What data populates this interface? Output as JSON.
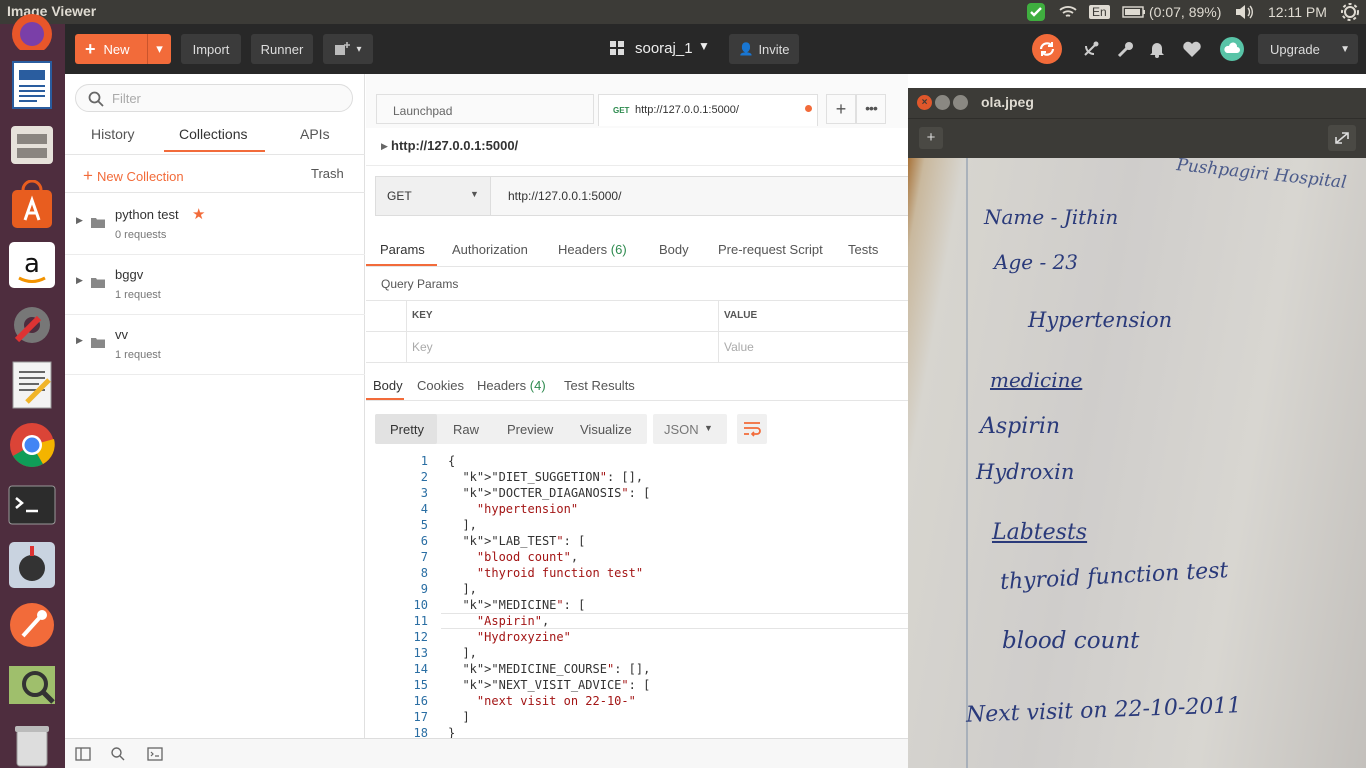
{
  "topbar": {
    "app_title": "Image Viewer",
    "keyboard": "En",
    "battery": "(0:07, 89%)",
    "clock": "12:11 PM"
  },
  "header": {
    "new_label": "New",
    "import_label": "Import",
    "runner_label": "Runner",
    "workspace": "sooraj_1",
    "invite_label": "Invite",
    "upgrade_label": "Upgrade"
  },
  "sidebar": {
    "filter_placeholder": "Filter",
    "tabs": [
      "History",
      "Collections",
      "APIs"
    ],
    "new_collection": "New Collection",
    "trash": "Trash",
    "collections": [
      {
        "name": "python test",
        "count": "0 requests",
        "starred": true
      },
      {
        "name": "bggv",
        "count": "1 request",
        "starred": false
      },
      {
        "name": "vv",
        "count": "1 request",
        "starred": false
      }
    ]
  },
  "request": {
    "tabs": [
      {
        "label": "Launchpad"
      },
      {
        "method": "GET",
        "label": "http://127.0.0.1:5000/"
      }
    ],
    "breadcrumb": "http://127.0.0.1:5000/",
    "method": "GET",
    "url": "http://127.0.0.1:5000/",
    "subtabs": [
      "Params",
      "Authorization",
      "Headers",
      "(6)",
      "Body",
      "Pre-request Script",
      "Tests"
    ],
    "query_params_label": "Query Params",
    "key_header": "KEY",
    "value_header": "VALUE",
    "key_placeholder": "Key",
    "value_placeholder": "Value"
  },
  "response": {
    "tabs": [
      "Body",
      "Cookies",
      "Headers",
      "(4)",
      "Test Results"
    ],
    "views": [
      "Pretty",
      "Raw",
      "Preview",
      "Visualize"
    ],
    "format": "JSON",
    "lines": [
      "{",
      "  \"DIET_SUGGETION\": [],",
      "  \"DOCTER_DIAGANOSIS\": [",
      "    \"hypertension\"",
      "  ],",
      "  \"LAB_TEST\": [",
      "    \"blood count\",",
      "    \"thyroid function test\"",
      "  ],",
      "  \"MEDICINE\": [",
      "    \"Aspirin\",",
      "    \"Hydroxyzine\"",
      "  ],",
      "  \"MEDICINE_COURSE\": [],",
      "  \"NEXT_VISIT_ADVICE\": [",
      "    \"next visit on 22-10-\"",
      "  ]",
      "}"
    ],
    "line_numbers": [
      "1",
      "2",
      "3",
      "4",
      "5",
      "6",
      "7",
      "8",
      "9",
      "10",
      "11",
      "12",
      "13",
      "14",
      "15",
      "16",
      "17",
      "18"
    ]
  },
  "viewer": {
    "filename": "ola.jpeg",
    "note_lines": [
      "Pushpagiri Hospital",
      "Name - Jithin",
      "Age - 23",
      "Hypertension",
      "medicine",
      "Aspirin",
      "Hydroxin",
      "Labtests",
      "thyroid function test",
      "blood count",
      "Next visit on 22-10-2011"
    ]
  },
  "colors": {
    "accent": "#f26b3a",
    "launcher": "#4e2d3e",
    "postman_header": "#282828"
  }
}
